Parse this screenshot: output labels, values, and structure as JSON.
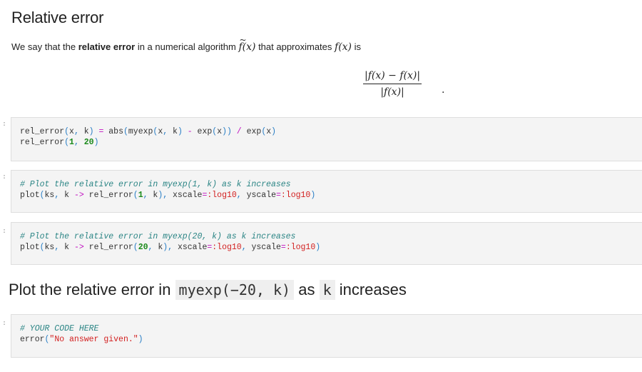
{
  "section": {
    "title": "Relative error",
    "intro": {
      "prefix": "We say that the ",
      "bold": "relative error",
      "middle": " in a numerical algorithm ",
      "math1": "f(x)",
      "after_math1": " that approximates ",
      "math2": "f(x)",
      "suffix": " is"
    },
    "formula": {
      "numerator": "|f(x) − f(x)|",
      "numerator_left": "|f",
      "numerator_right": "(x) − f(x)|",
      "denominator": "|f(x)|",
      "trailing": "."
    }
  },
  "cells": [
    {
      "prompt": ":",
      "lines": [
        [
          {
            "t": "rel_error",
            "c": "fn"
          },
          {
            "t": "(",
            "c": "punct"
          },
          {
            "t": "x",
            "c": "fn"
          },
          {
            "t": ", ",
            "c": "punct"
          },
          {
            "t": "k",
            "c": "fn"
          },
          {
            "t": ")",
            "c": "punct"
          },
          {
            "t": " ",
            "c": "fn"
          },
          {
            "t": "=",
            "c": "op"
          },
          {
            "t": " abs",
            "c": "fn"
          },
          {
            "t": "(",
            "c": "punct"
          },
          {
            "t": "myexp",
            "c": "fn"
          },
          {
            "t": "(",
            "c": "punct"
          },
          {
            "t": "x",
            "c": "fn"
          },
          {
            "t": ", ",
            "c": "punct"
          },
          {
            "t": "k",
            "c": "fn"
          },
          {
            "t": ")",
            "c": "punct"
          },
          {
            "t": " ",
            "c": "fn"
          },
          {
            "t": "-",
            "c": "op"
          },
          {
            "t": " exp",
            "c": "fn"
          },
          {
            "t": "(",
            "c": "punct"
          },
          {
            "t": "x",
            "c": "fn"
          },
          {
            "t": "))",
            "c": "punct"
          },
          {
            "t": " ",
            "c": "fn"
          },
          {
            "t": "/",
            "c": "op"
          },
          {
            "t": " exp",
            "c": "fn"
          },
          {
            "t": "(",
            "c": "punct"
          },
          {
            "t": "x",
            "c": "fn"
          },
          {
            "t": ")",
            "c": "punct"
          }
        ],
        [
          {
            "t": "rel_error",
            "c": "fn"
          },
          {
            "t": "(",
            "c": "punct"
          },
          {
            "t": "1",
            "c": "num"
          },
          {
            "t": ", ",
            "c": "punct"
          },
          {
            "t": "20",
            "c": "num"
          },
          {
            "t": ")",
            "c": "punct"
          }
        ]
      ]
    },
    {
      "prompt": ":",
      "lines": [
        [
          {
            "t": "# Plot the relative error in myexp(1, k) as k increases",
            "c": "cmt"
          }
        ],
        [
          {
            "t": "plot",
            "c": "fn"
          },
          {
            "t": "(",
            "c": "punct"
          },
          {
            "t": "ks",
            "c": "fn"
          },
          {
            "t": ", ",
            "c": "punct"
          },
          {
            "t": "k ",
            "c": "fn"
          },
          {
            "t": "->",
            "c": "op"
          },
          {
            "t": " rel_error",
            "c": "fn"
          },
          {
            "t": "(",
            "c": "punct"
          },
          {
            "t": "1",
            "c": "num"
          },
          {
            "t": ", ",
            "c": "punct"
          },
          {
            "t": "k",
            "c": "fn"
          },
          {
            "t": "), ",
            "c": "punct"
          },
          {
            "t": "xscale",
            "c": "fn"
          },
          {
            "t": "=",
            "c": "op"
          },
          {
            "t": ":log10",
            "c": "sym"
          },
          {
            "t": ", ",
            "c": "punct"
          },
          {
            "t": "yscale",
            "c": "fn"
          },
          {
            "t": "=",
            "c": "op"
          },
          {
            "t": ":log10",
            "c": "sym"
          },
          {
            "t": ")",
            "c": "punct"
          }
        ]
      ]
    },
    {
      "prompt": ":",
      "lines": [
        [
          {
            "t": "# Plot the relative error in myexp(20, k) as k increases",
            "c": "cmt"
          }
        ],
        [
          {
            "t": "plot",
            "c": "fn"
          },
          {
            "t": "(",
            "c": "punct"
          },
          {
            "t": "ks",
            "c": "fn"
          },
          {
            "t": ", ",
            "c": "punct"
          },
          {
            "t": "k ",
            "c": "fn"
          },
          {
            "t": "->",
            "c": "op"
          },
          {
            "t": " rel_error",
            "c": "fn"
          },
          {
            "t": "(",
            "c": "punct"
          },
          {
            "t": "20",
            "c": "num"
          },
          {
            "t": ", ",
            "c": "punct"
          },
          {
            "t": "k",
            "c": "fn"
          },
          {
            "t": "), ",
            "c": "punct"
          },
          {
            "t": "xscale",
            "c": "fn"
          },
          {
            "t": "=",
            "c": "op"
          },
          {
            "t": ":log10",
            "c": "sym"
          },
          {
            "t": ", ",
            "c": "punct"
          },
          {
            "t": "yscale",
            "c": "fn"
          },
          {
            "t": "=",
            "c": "op"
          },
          {
            "t": ":log10",
            "c": "sym"
          },
          {
            "t": ")",
            "c": "punct"
          }
        ]
      ]
    },
    {
      "prompt": ":",
      "lines": [
        [
          {
            "t": "# YOUR CODE HERE",
            "c": "cmt"
          }
        ],
        [
          {
            "t": "error",
            "c": "fn"
          },
          {
            "t": "(",
            "c": "punct"
          },
          {
            "t": "\"No answer given.\"",
            "c": "str"
          },
          {
            "t": ")",
            "c": "punct"
          }
        ]
      ]
    }
  ],
  "subsection": {
    "prefix": "Plot the relative error in ",
    "code1": "myexp(−20, k)",
    "middle": " as ",
    "code2": "k",
    "suffix": " increases"
  },
  "colors": {
    "operator": "#c011c0",
    "punctuation": "#2a7fc6",
    "number": "#1b8a1b",
    "symbol_string": "#d21f1f",
    "comment": "#2b8585",
    "cell_background": "#f4f4f4"
  }
}
